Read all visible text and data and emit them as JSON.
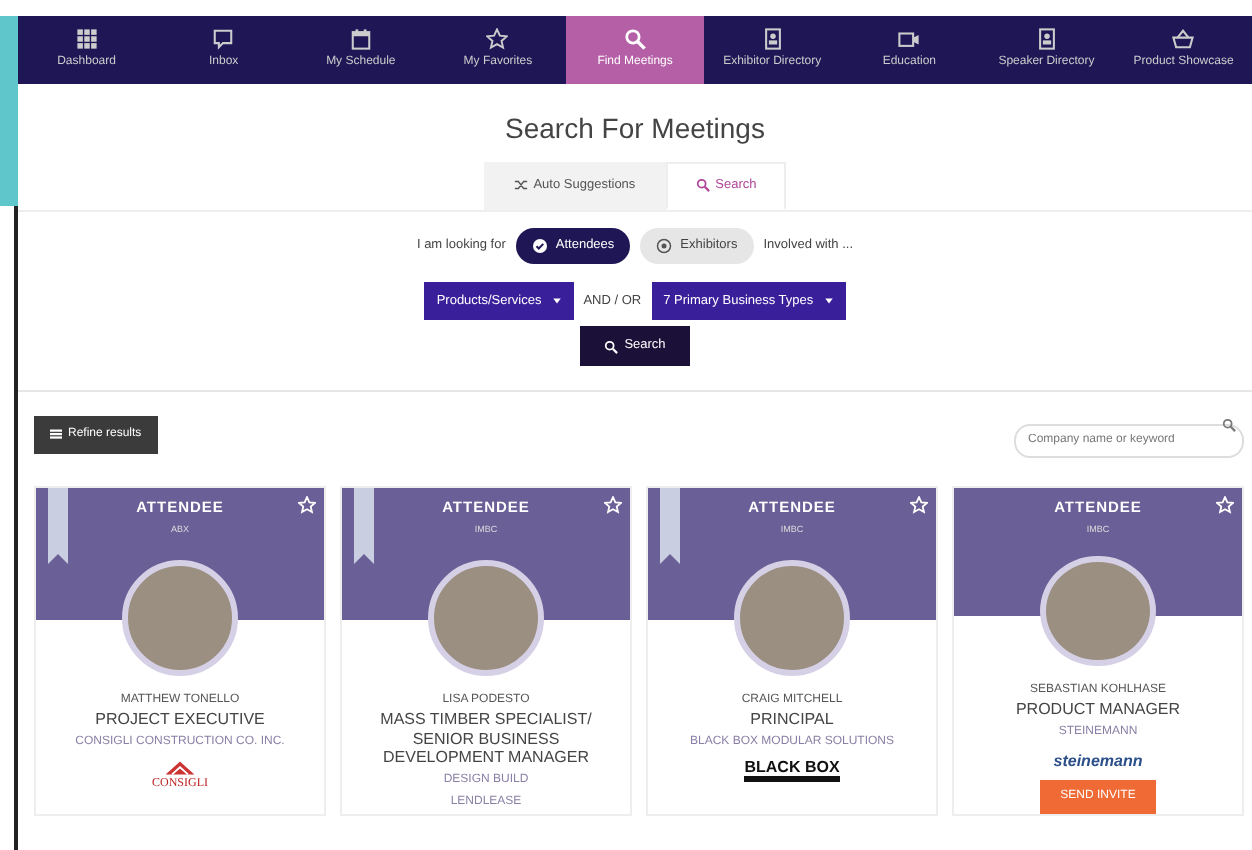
{
  "nav": [
    {
      "label": "Dashboard",
      "selected": false
    },
    {
      "label": "Inbox",
      "selected": false
    },
    {
      "label": "My Schedule",
      "selected": false
    },
    {
      "label": "My Favorites",
      "selected": false
    },
    {
      "label": "Find Meetings",
      "selected": true
    },
    {
      "label": "Exhibitor Directory",
      "selected": false
    },
    {
      "label": "Education",
      "selected": false
    },
    {
      "label": "Speaker Directory",
      "selected": false
    },
    {
      "label": "Product Showcase",
      "selected": false
    }
  ],
  "title": "Search For Meetings",
  "tabs": [
    {
      "label": "Auto Suggestions",
      "selected": false
    },
    {
      "label": "Search",
      "selected": true
    }
  ],
  "looking_for": {
    "label": "I am looking for",
    "options": [
      {
        "label": "Attendees",
        "selected": true
      },
      {
        "label": "Exhibitors",
        "selected": false
      }
    ],
    "suffix": "Involved with ..."
  },
  "filters": {
    "first": "Products/Services",
    "joiner": "AND / OR",
    "second": "7 Primary Business Types"
  },
  "search_button": "Search",
  "refine_button": "Refine results",
  "keyword_search": {
    "placeholder": "Company name or keyword"
  },
  "cards": [
    {
      "role": "ATTENDEE",
      "event": "ABX",
      "ribbon": true,
      "name": "MATTHEW TONELLO",
      "title": "PROJECT EXECUTIVE",
      "company": "CONSIGLI CONSTRUCTION CO. INC.",
      "logo": {
        "kind": "roof",
        "text": "CONSIGLI"
      }
    },
    {
      "role": "ATTENDEE",
      "event": "IMBC",
      "ribbon": true,
      "name": "LISA PODESTO",
      "title": "MASS TIMBER SPECIALIST/ SENIOR BUSINESS DEVELOPMENT MANAGER",
      "company": "DESIGN BUILD",
      "company_2": "LENDLEASE"
    },
    {
      "role": "ATTENDEE",
      "event": "IMBC",
      "ribbon": true,
      "name": "CRAIG MITCHELL",
      "title": "PRINCIPAL",
      "company": "BLACK BOX MODULAR SOLUTIONS",
      "logo": {
        "kind": "boxed",
        "text": "BLACK BOX"
      }
    },
    {
      "role": "ATTENDEE",
      "event": "IMBC",
      "ribbon": false,
      "name": "SEBASTIAN KOHLHASE",
      "title": "PRODUCT MANAGER",
      "company": "STEINEMANN",
      "logo": {
        "kind": "script",
        "text": "steinemann"
      },
      "action": "SEND INVITE"
    }
  ]
}
